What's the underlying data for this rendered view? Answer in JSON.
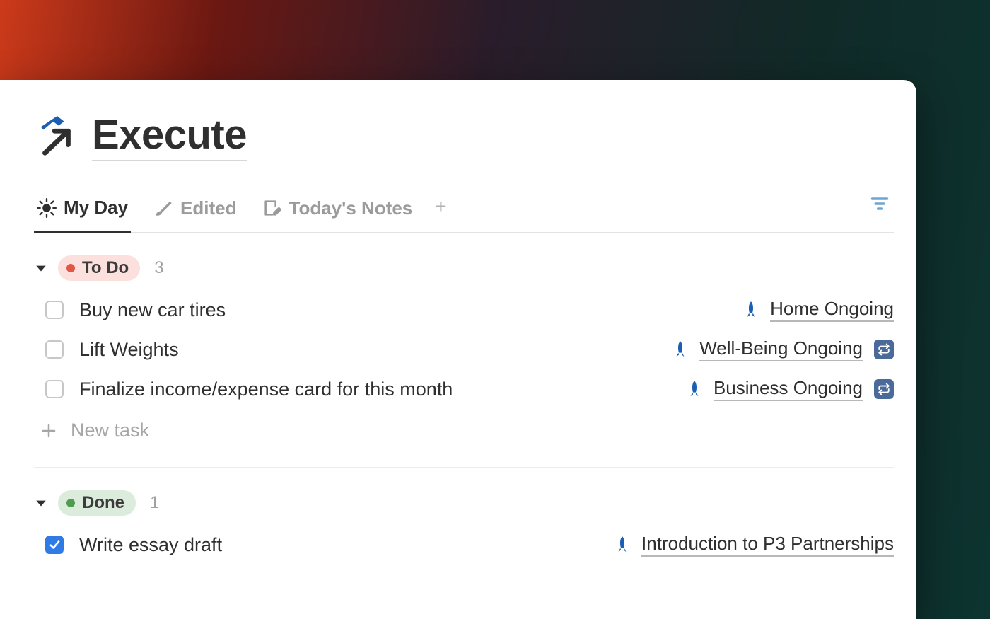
{
  "page": {
    "title": "Execute"
  },
  "tabs": {
    "my_day": "My Day",
    "edited": "Edited",
    "todays_notes": "Today's Notes"
  },
  "groups": {
    "todo": {
      "label": "To Do",
      "count": "3",
      "items": [
        {
          "title": "Buy new car tires",
          "category": "Home Ongoing",
          "repeat": false
        },
        {
          "title": "Lift Weights",
          "category": "Well-Being Ongoing",
          "repeat": true
        },
        {
          "title": "Finalize income/expense card for this month",
          "category": "Business Ongoing",
          "repeat": true
        }
      ]
    },
    "done": {
      "label": "Done",
      "count": "1",
      "items": [
        {
          "title": "Write essay draft",
          "category": "Introduction to P3 Partnerships",
          "repeat": false
        }
      ]
    }
  },
  "actions": {
    "new_task": "New task"
  }
}
